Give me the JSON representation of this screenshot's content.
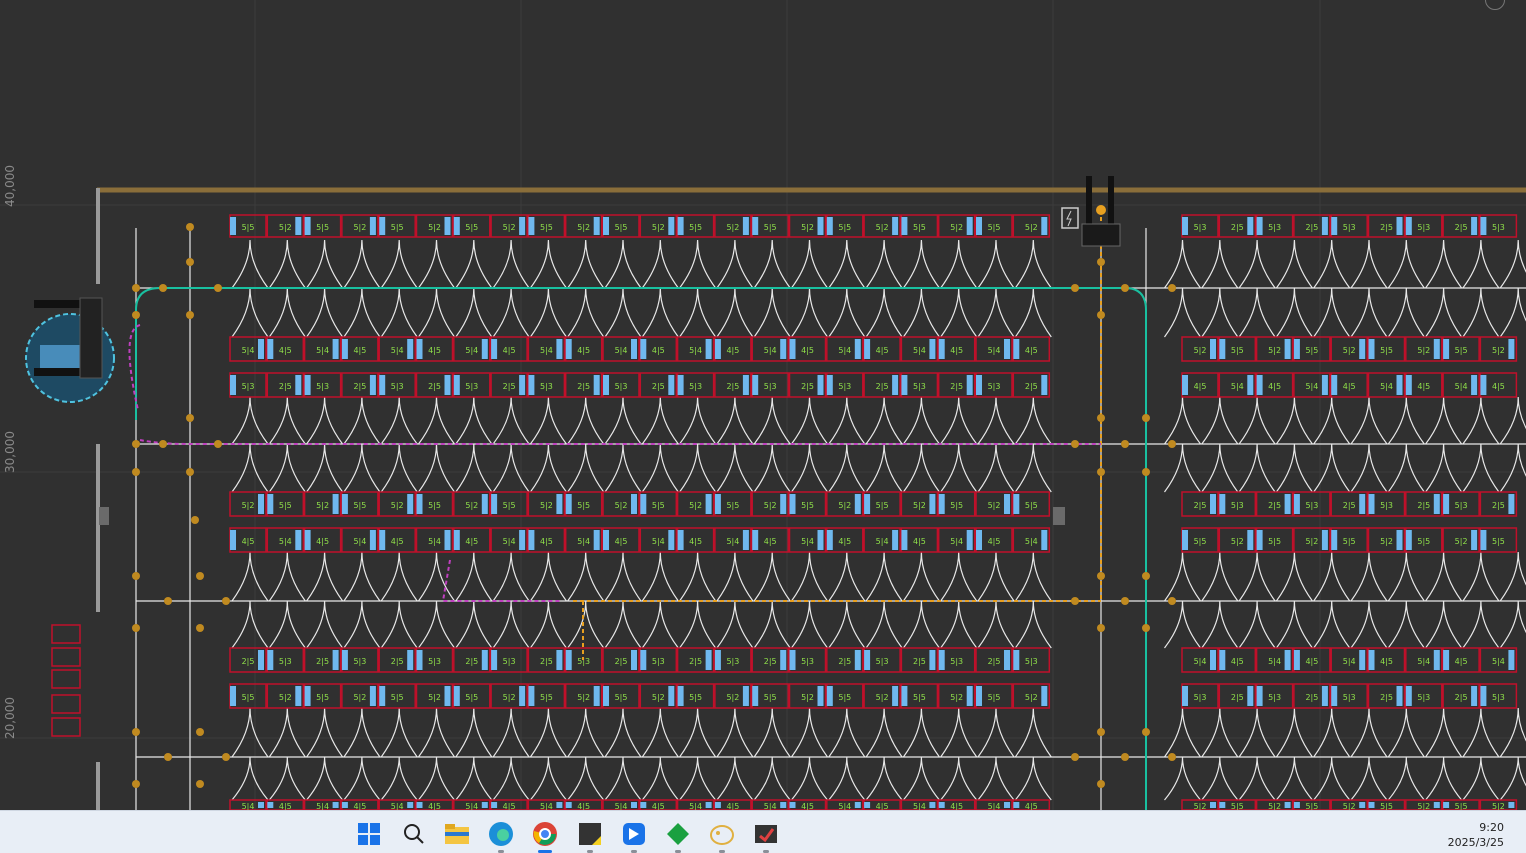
{
  "axis": {
    "y_labels": [
      "40,000",
      "30,000",
      "20,000"
    ]
  },
  "colors": {
    "background": "#303030",
    "wall": "#8a6e3a",
    "shelf": "#c0102a",
    "lane": "#e8e8e8",
    "route_teal": "#19c0a0",
    "route_orange": "#e8a020",
    "route_magenta": "#c040c0",
    "node": "#c08a20"
  },
  "shelf_codes": [
    "5|5",
    "5|4",
    "5|3",
    "5|2",
    "4|5",
    "2|5"
  ],
  "taskbar": {
    "apps": [
      "start-icon",
      "search-icon",
      "file-explorer-icon",
      "edge-icon",
      "chrome-icon",
      "sticky-notes-icon",
      "app-blue-icon",
      "app-green-icon",
      "app-yellow-icon",
      "app-screenshot-icon"
    ],
    "time": "9:20",
    "date": "2025/3/25"
  }
}
